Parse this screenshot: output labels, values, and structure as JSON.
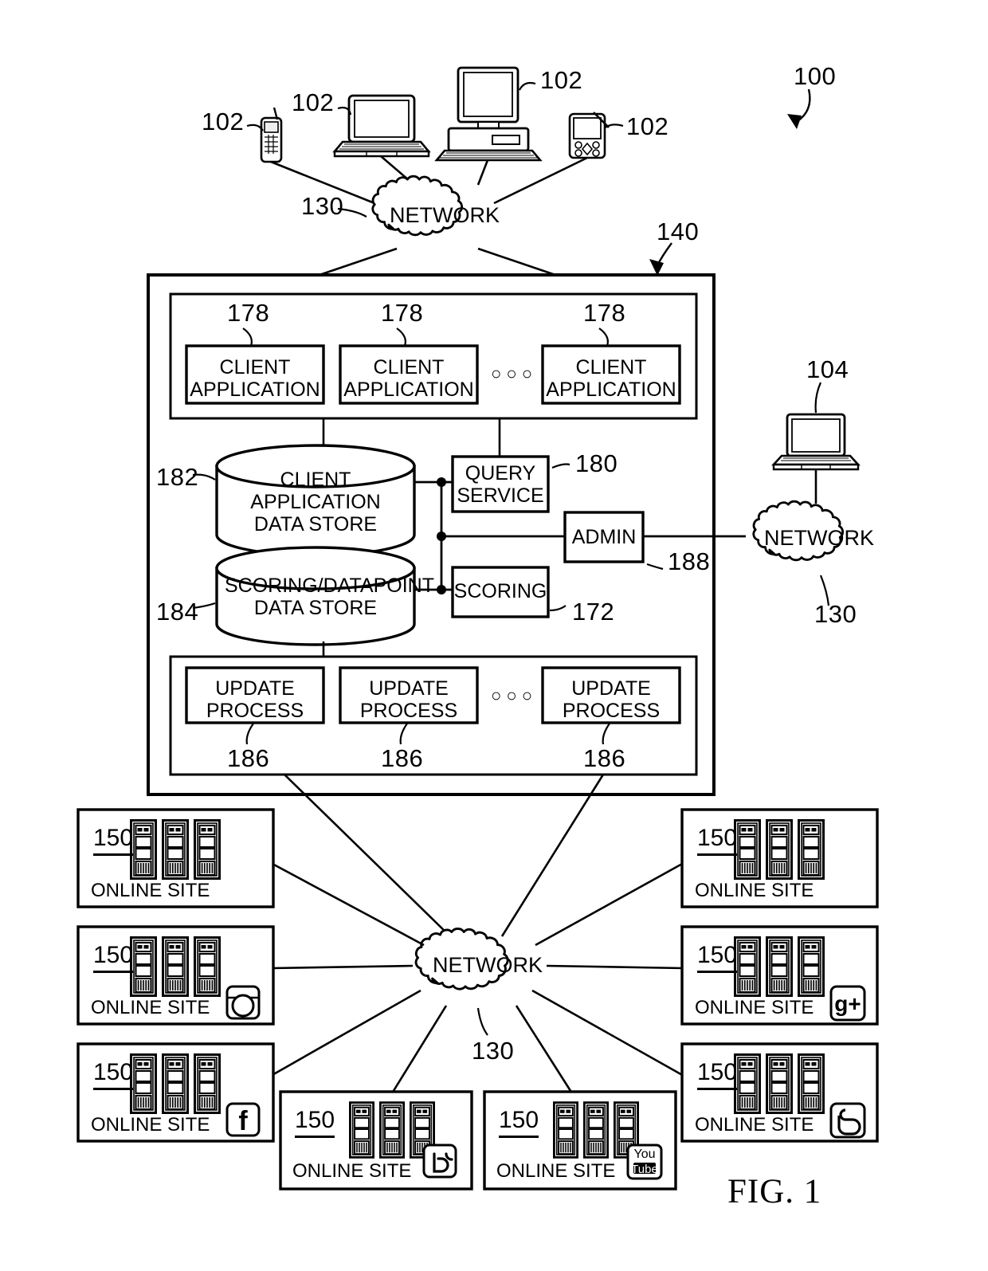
{
  "figure": {
    "caption": "FIG. 1",
    "system_ref": "100"
  },
  "client_devices": {
    "ref": "102",
    "labels": [
      "102",
      "102",
      "102",
      "102"
    ],
    "device_icons": [
      "mobile-phone-icon",
      "laptop-icon",
      "desktop-computer-icon",
      "pda-icon"
    ]
  },
  "networks": {
    "top": {
      "label": "NETWORK",
      "ref": "130"
    },
    "right": {
      "label": "NETWORK",
      "ref": "130"
    },
    "bottom": {
      "label": "NETWORK",
      "ref": "130"
    }
  },
  "admin_terminal": {
    "ref": "104",
    "icon": "laptop-icon"
  },
  "system": {
    "ref": "140",
    "client_application_group": {
      "items": [
        {
          "label": "CLIENT\nAPPLICATION",
          "ref": "178"
        },
        {
          "label": "CLIENT\nAPPLICATION",
          "ref": "178"
        },
        {
          "label": "CLIENT\nAPPLICATION",
          "ref": "178"
        }
      ],
      "ellipsis": "○ ○ ○"
    },
    "data_stores": [
      {
        "label": "CLIENT APPLICATION\nDATA STORE",
        "ref": "182"
      },
      {
        "label": "SCORING/DATAPOINT\nDATA STORE",
        "ref": "184"
      }
    ],
    "services": [
      {
        "label": "QUERY\nSERVICE",
        "ref": "180"
      },
      {
        "label": "SCORING",
        "ref": "172"
      },
      {
        "label": "ADMIN",
        "ref": "188"
      }
    ],
    "update_process_group": {
      "items": [
        {
          "label": "UPDATE\nPROCESS",
          "ref": "186"
        },
        {
          "label": "UPDATE\nPROCESS",
          "ref": "186"
        },
        {
          "label": "UPDATE\nPROCESS",
          "ref": "186"
        }
      ],
      "ellipsis": "○ ○ ○"
    }
  },
  "online_sites": [
    {
      "ref": "150",
      "label": "ONLINE SITE",
      "icon": "none"
    },
    {
      "ref": "150",
      "label": "ONLINE SITE",
      "icon": "instagram-icon"
    },
    {
      "ref": "150",
      "label": "ONLINE SITE",
      "icon": "facebook-icon"
    },
    {
      "ref": "150",
      "label": "ONLINE SITE",
      "icon": "twitter-icon"
    },
    {
      "ref": "150",
      "label": "ONLINE SITE",
      "icon": "youtube-icon"
    },
    {
      "ref": "150",
      "label": "ONLINE SITE",
      "icon": "none"
    },
    {
      "ref": "150",
      "label": "ONLINE SITE",
      "icon": "googleplus-icon"
    },
    {
      "ref": "150",
      "label": "ONLINE SITE",
      "icon": "blogger-icon"
    }
  ],
  "icon_text": {
    "facebook": "f",
    "googleplus": "g+",
    "youtube_top": "You",
    "youtube_bottom": "Tube",
    "blogger": "b"
  },
  "colors": {
    "line": "#000000",
    "background": "#ffffff",
    "server_fill": "#d8d8d8"
  }
}
